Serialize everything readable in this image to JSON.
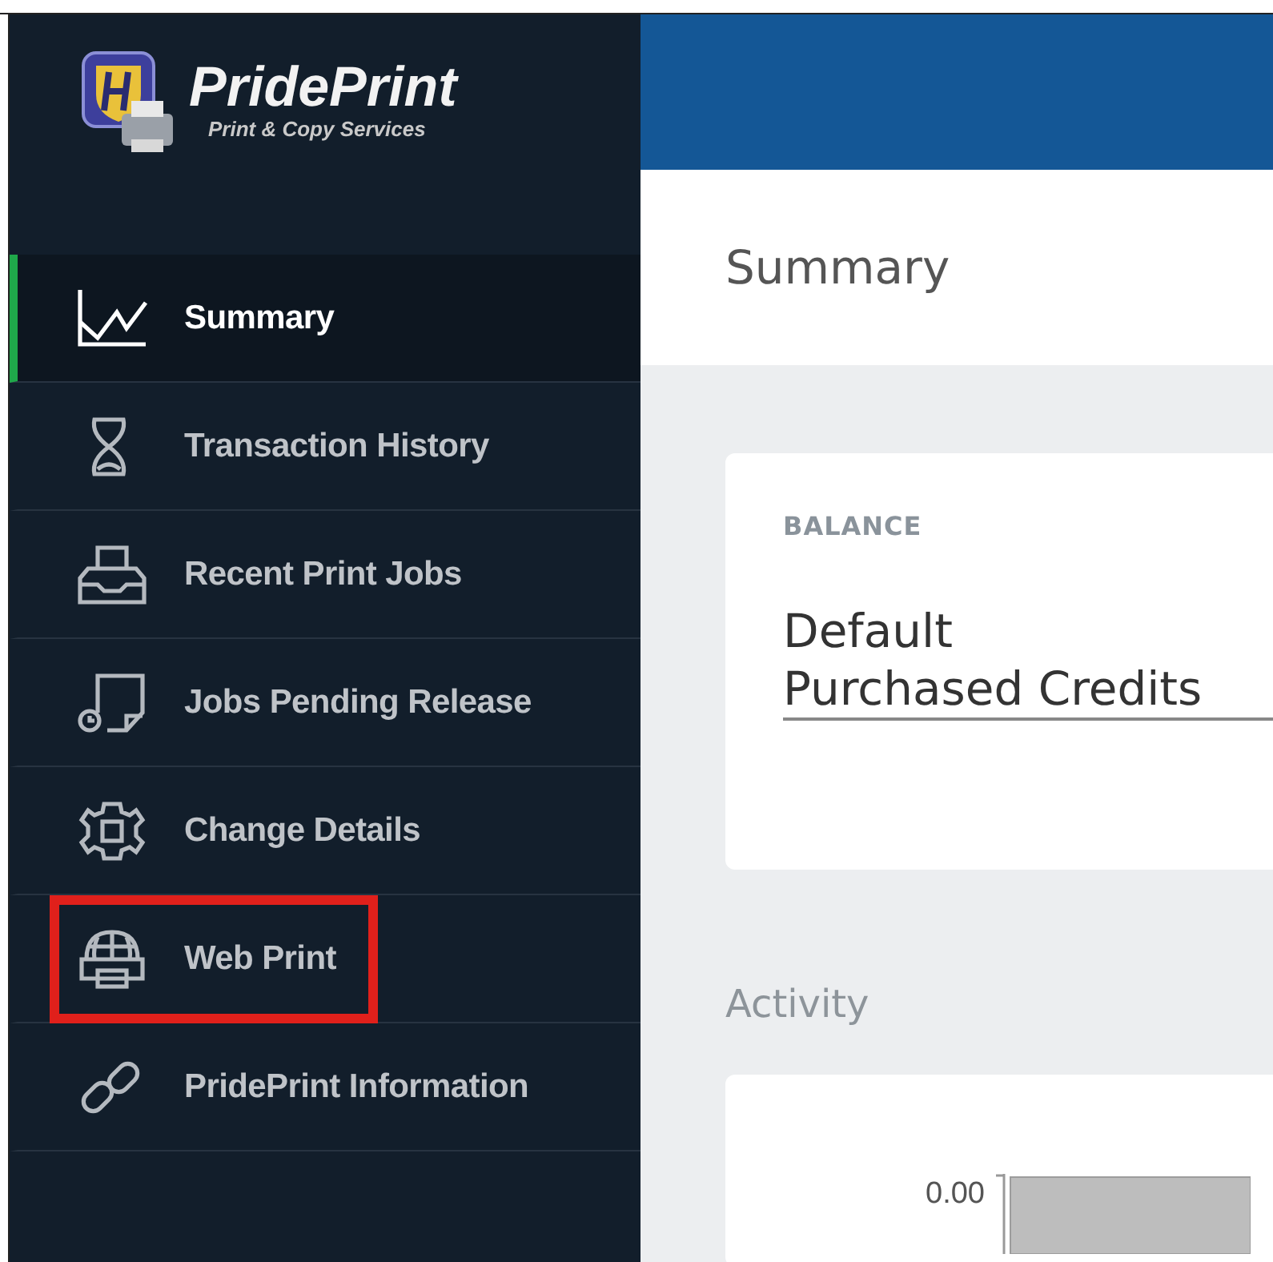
{
  "logo": {
    "title": "PridePrint",
    "subtitle": "Print & Copy Services"
  },
  "sidebar": {
    "items": [
      {
        "label": "Summary",
        "kind": "chart",
        "selected": true,
        "highlighted": false
      },
      {
        "label": "Transaction History",
        "kind": "hourglass",
        "selected": false,
        "highlighted": false
      },
      {
        "label": "Recent Print Jobs",
        "kind": "tray",
        "selected": false,
        "highlighted": false
      },
      {
        "label": "Jobs Pending Release",
        "kind": "pending",
        "selected": false,
        "highlighted": false
      },
      {
        "label": "Change Details",
        "kind": "gear",
        "selected": false,
        "highlighted": false
      },
      {
        "label": "Web Print",
        "kind": "webprint",
        "selected": false,
        "highlighted": true
      },
      {
        "label": "PridePrint Information",
        "kind": "link",
        "selected": false,
        "highlighted": false
      }
    ]
  },
  "page_title": "Summary",
  "balance": {
    "heading": "BALANCE",
    "account": "Default",
    "value": "Purchased Credits"
  },
  "activity": {
    "heading": "Activity",
    "tick_label": "0.00"
  }
}
